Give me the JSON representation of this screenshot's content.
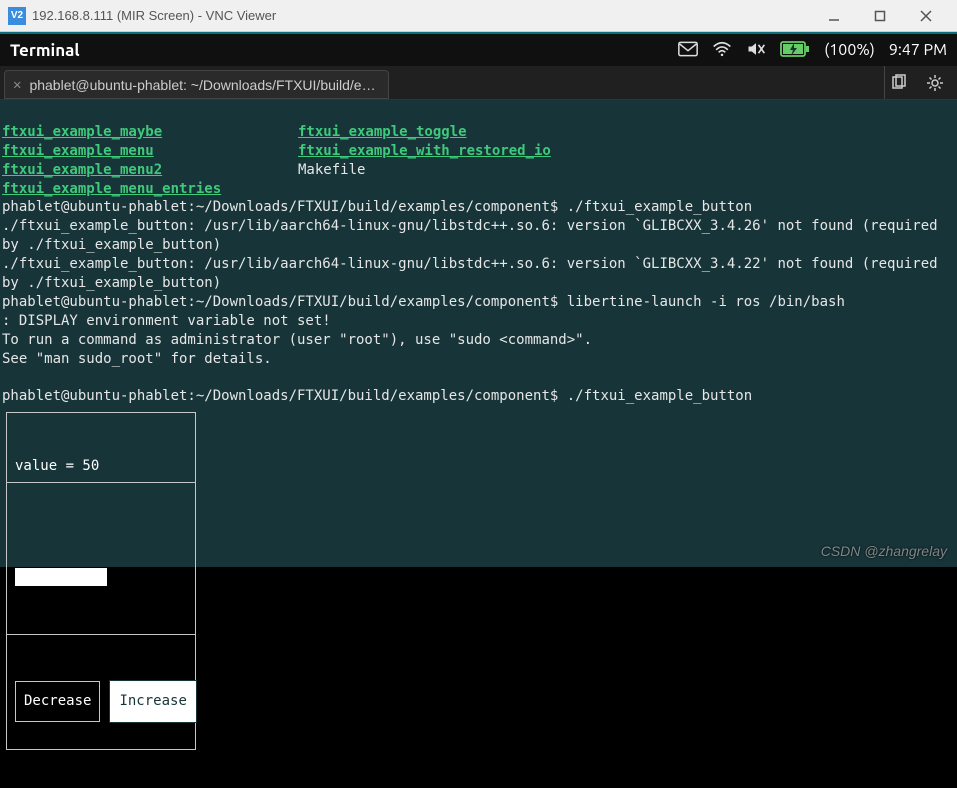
{
  "window": {
    "vnc_badge": "V2",
    "title": "192.168.8.111 (MIR Screen) - VNC Viewer"
  },
  "topbar": {
    "title": "Terminal",
    "battery_pct": "(100%)",
    "time": "9:47 PM"
  },
  "tab": {
    "label": "phablet@ubuntu-phablet: ~/Downloads/FTXUI/build/e…"
  },
  "listing": {
    "col1": [
      "ftxui_example_maybe",
      "ftxui_example_menu",
      "ftxui_example_menu2",
      "ftxui_example_menu_entries"
    ],
    "col2_exec": [
      "ftxui_example_toggle",
      "ftxui_example_with_restored_io"
    ],
    "col2_plain": "Makefile"
  },
  "terminal_lines": {
    "prompt1": "phablet@ubuntu-phablet:~/Downloads/FTXUI/build/examples/component$ ./ftxui_example_button",
    "err1": "./ftxui_example_button: /usr/lib/aarch64-linux-gnu/libstdc++.so.6: version `GLIBCXX_3.4.26' not found (required by ./ftxui_example_button)",
    "err2": "./ftxui_example_button: /usr/lib/aarch64-linux-gnu/libstdc++.so.6: version `GLIBCXX_3.4.22' not found (required by ./ftxui_example_button)",
    "prompt2": "phablet@ubuntu-phablet:~/Downloads/FTXUI/build/examples/component$ libertine-launch -i ros /bin/bash",
    "disp_err": ": DISPLAY environment variable not set!",
    "sudo1": "To run a command as administrator (user \"root\"), use \"sudo <command>\".",
    "sudo2": "See \"man sudo_root\" for details.",
    "prompt3": "phablet@ubuntu-phablet:~/Downloads/FTXUI/build/examples/component$ ./ftxui_example_button"
  },
  "tui": {
    "value_label": "value = 50",
    "decrease": "Decrease",
    "increase": "Increase"
  },
  "watermark": "CSDN @zhangrelay"
}
